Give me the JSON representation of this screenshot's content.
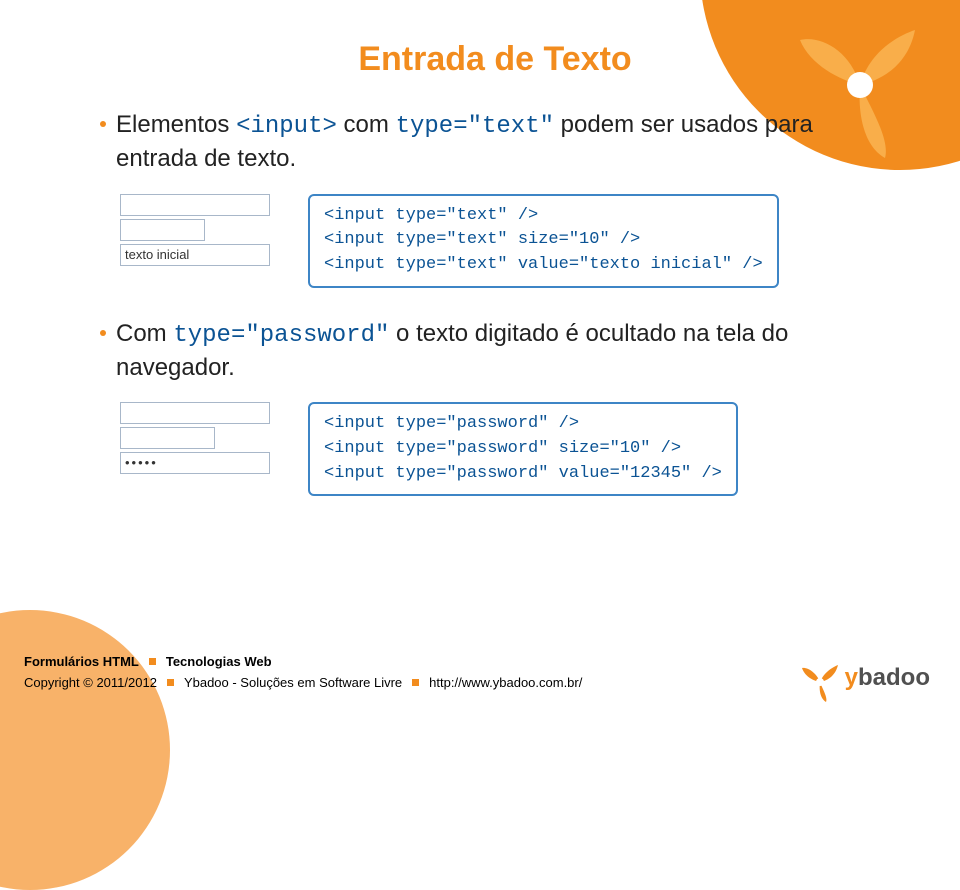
{
  "title": "Entrada de Texto",
  "bullet1_pre": "Elementos ",
  "bullet1_code": "<input>",
  "bullet1_mid": " com ",
  "bullet1_code2": "type=\"text\"",
  "bullet1_post": " podem ser usados para entrada de texto.",
  "example1_input3_value": "texto inicial",
  "code1_line1": "<input type=\"text\" />",
  "code1_line2": "<input type=\"text\" size=\"10\" />",
  "code1_line3": "<input type=\"text\" value=\"texto inicial\" />",
  "bullet2_pre": "Com ",
  "bullet2_code": "type=\"password\"",
  "bullet2_post": " o texto digitado é ocultado na tela do navegador.",
  "example2_input3_value": "•••••",
  "code2_line1": "<input type=\"password\" />",
  "code2_line2": "<input type=\"password\" size=\"10\" />",
  "code2_line3": "<input type=\"password\" value=\"12345\" />",
  "footer": {
    "left1": "Formulários HTML",
    "left2": "Tecnologias Web",
    "copyright": "Copyright © 2011/2012",
    "company": "Ybadoo - Soluções em Software Livre",
    "url": "http://www.ybadoo.com.br/"
  },
  "logo": {
    "prefix": "y",
    "rest": "badoo"
  }
}
